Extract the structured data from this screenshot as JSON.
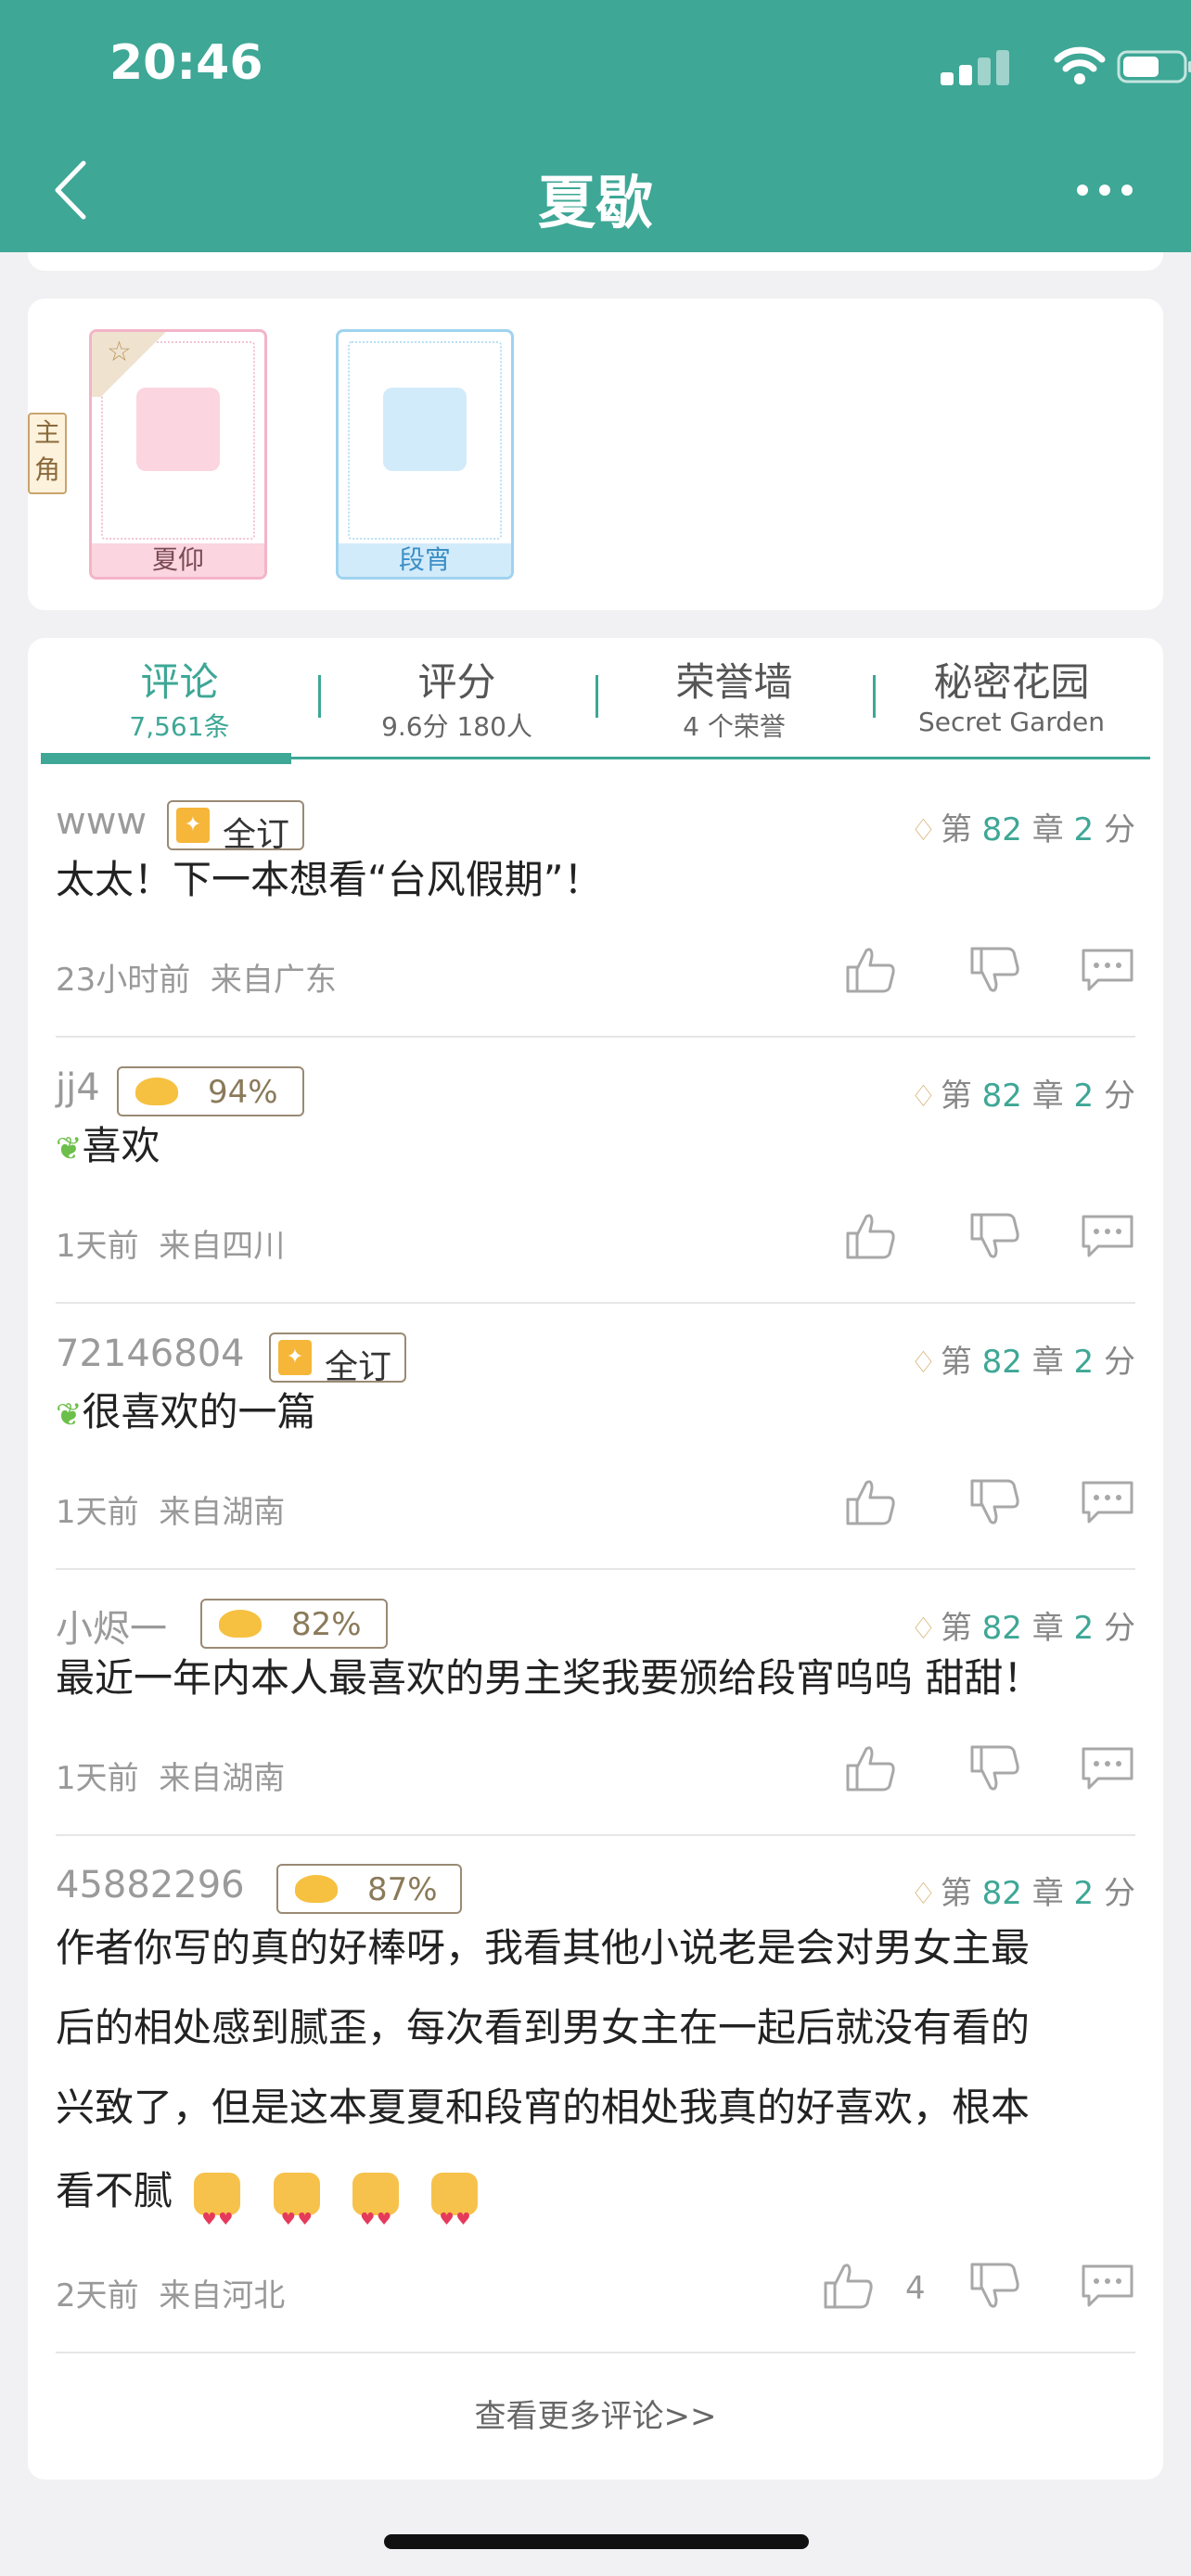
{
  "status_bar": {
    "time": "20:46"
  },
  "nav": {
    "title": "夏歇"
  },
  "characters": {
    "role_tag": "主角",
    "items": [
      {
        "name": "夏仰"
      },
      {
        "name": "段宵"
      }
    ]
  },
  "tabs": [
    {
      "label": "评论",
      "sub": "7,561条"
    },
    {
      "label": "评分",
      "sub": "9.6分 180人"
    },
    {
      "label": "荣誉墙",
      "sub": "4 个荣誉"
    },
    {
      "label": "秘密花园",
      "sub": "Secret Garden"
    }
  ],
  "comments": [
    {
      "user": "www",
      "badge": "全订",
      "chapter_prefix": "第",
      "chapter": "82",
      "chapter_unit": "章",
      "score": "2",
      "score_unit": "分",
      "text": "太太！下一本想看“台风假期”！",
      "time": "23小时前",
      "location": "来自广东"
    },
    {
      "user": "jj4",
      "badge": "94%",
      "chapter_prefix": "第",
      "chapter": "82",
      "chapter_unit": "章",
      "score": "2",
      "score_unit": "分",
      "text": "喜欢",
      "time": "1天前",
      "location": "来自四川"
    },
    {
      "user": "72146804",
      "badge": "全订",
      "chapter_prefix": "第",
      "chapter": "82",
      "chapter_unit": "章",
      "score": "2",
      "score_unit": "分",
      "text": "很喜欢的一篇",
      "time": "1天前",
      "location": "来自湖南"
    },
    {
      "user": "小烬一",
      "badge": "82%",
      "chapter_prefix": "第",
      "chapter": "82",
      "chapter_unit": "章",
      "score": "2",
      "score_unit": "分",
      "text": "最近一年内本人最喜欢的男主奖我要颁给段宵呜呜 甜甜！",
      "time": "1天前",
      "location": "来自湖南"
    },
    {
      "user": "45882296",
      "badge": "87%",
      "chapter_prefix": "第",
      "chapter": "82",
      "chapter_unit": "章",
      "score": "2",
      "score_unit": "分",
      "text_lines": [
        "作者你写的真的好棒呀，我看其他小说老是会对男女主最",
        "后的相处感到腻歪，每次看到男女主在一起后就没有看的",
        "兴致了，但是这本夏夏和段宵的相处我真的好喜欢，根本",
        "看不腻"
      ],
      "time": "2天前",
      "location": "来自河北",
      "likes": "4"
    }
  ],
  "more_comments": "查看更多评论>>",
  "colors": {
    "accent": "#3ea796",
    "background": "#f1f1f3"
  }
}
